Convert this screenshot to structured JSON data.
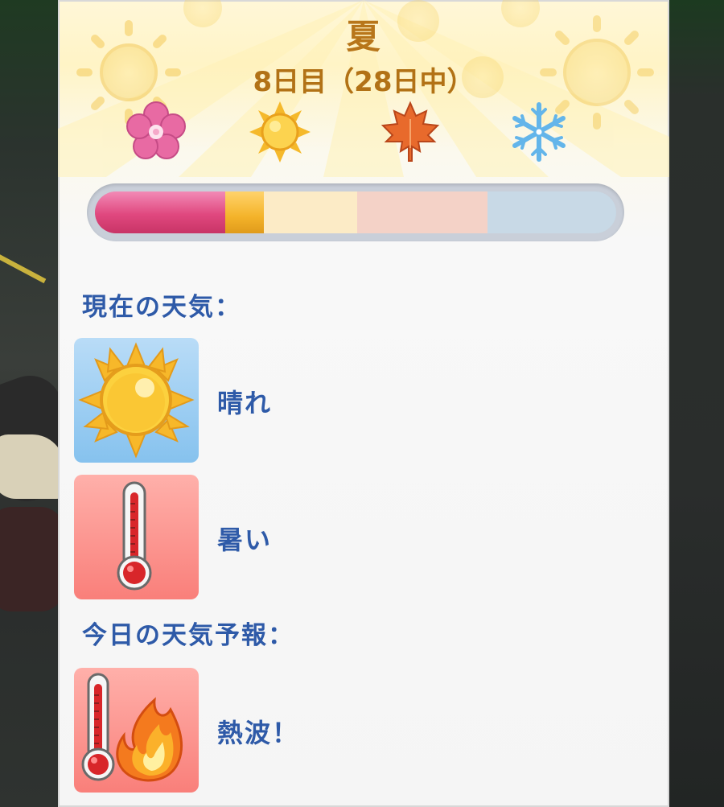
{
  "season": {
    "title": "夏",
    "day_text": "8日目（28日中）"
  },
  "season_icons": [
    "flower-icon",
    "sun-icon",
    "maple-leaf-icon",
    "snowflake-icon"
  ],
  "season_progress": {
    "seasons": [
      "spring",
      "summer",
      "fall",
      "winter"
    ],
    "current_day": 8,
    "total_days": 28,
    "colors": {
      "spring": "#e0487f",
      "summer": "#f4b32a",
      "fall": "#f4d2c7",
      "winter": "#c8d9e6"
    }
  },
  "current_weather": {
    "label": "現在の天気：",
    "items": [
      {
        "icon": "sun-icon",
        "text": "晴れ"
      },
      {
        "icon": "thermometer-icon",
        "text": "暑い"
      }
    ]
  },
  "forecast": {
    "label": "今日の天気予報：",
    "items": [
      {
        "icon": "heatwave-icon",
        "text": "熱波！"
      }
    ]
  },
  "colors": {
    "title": "#b8761a",
    "label": "#2e5aa8"
  }
}
